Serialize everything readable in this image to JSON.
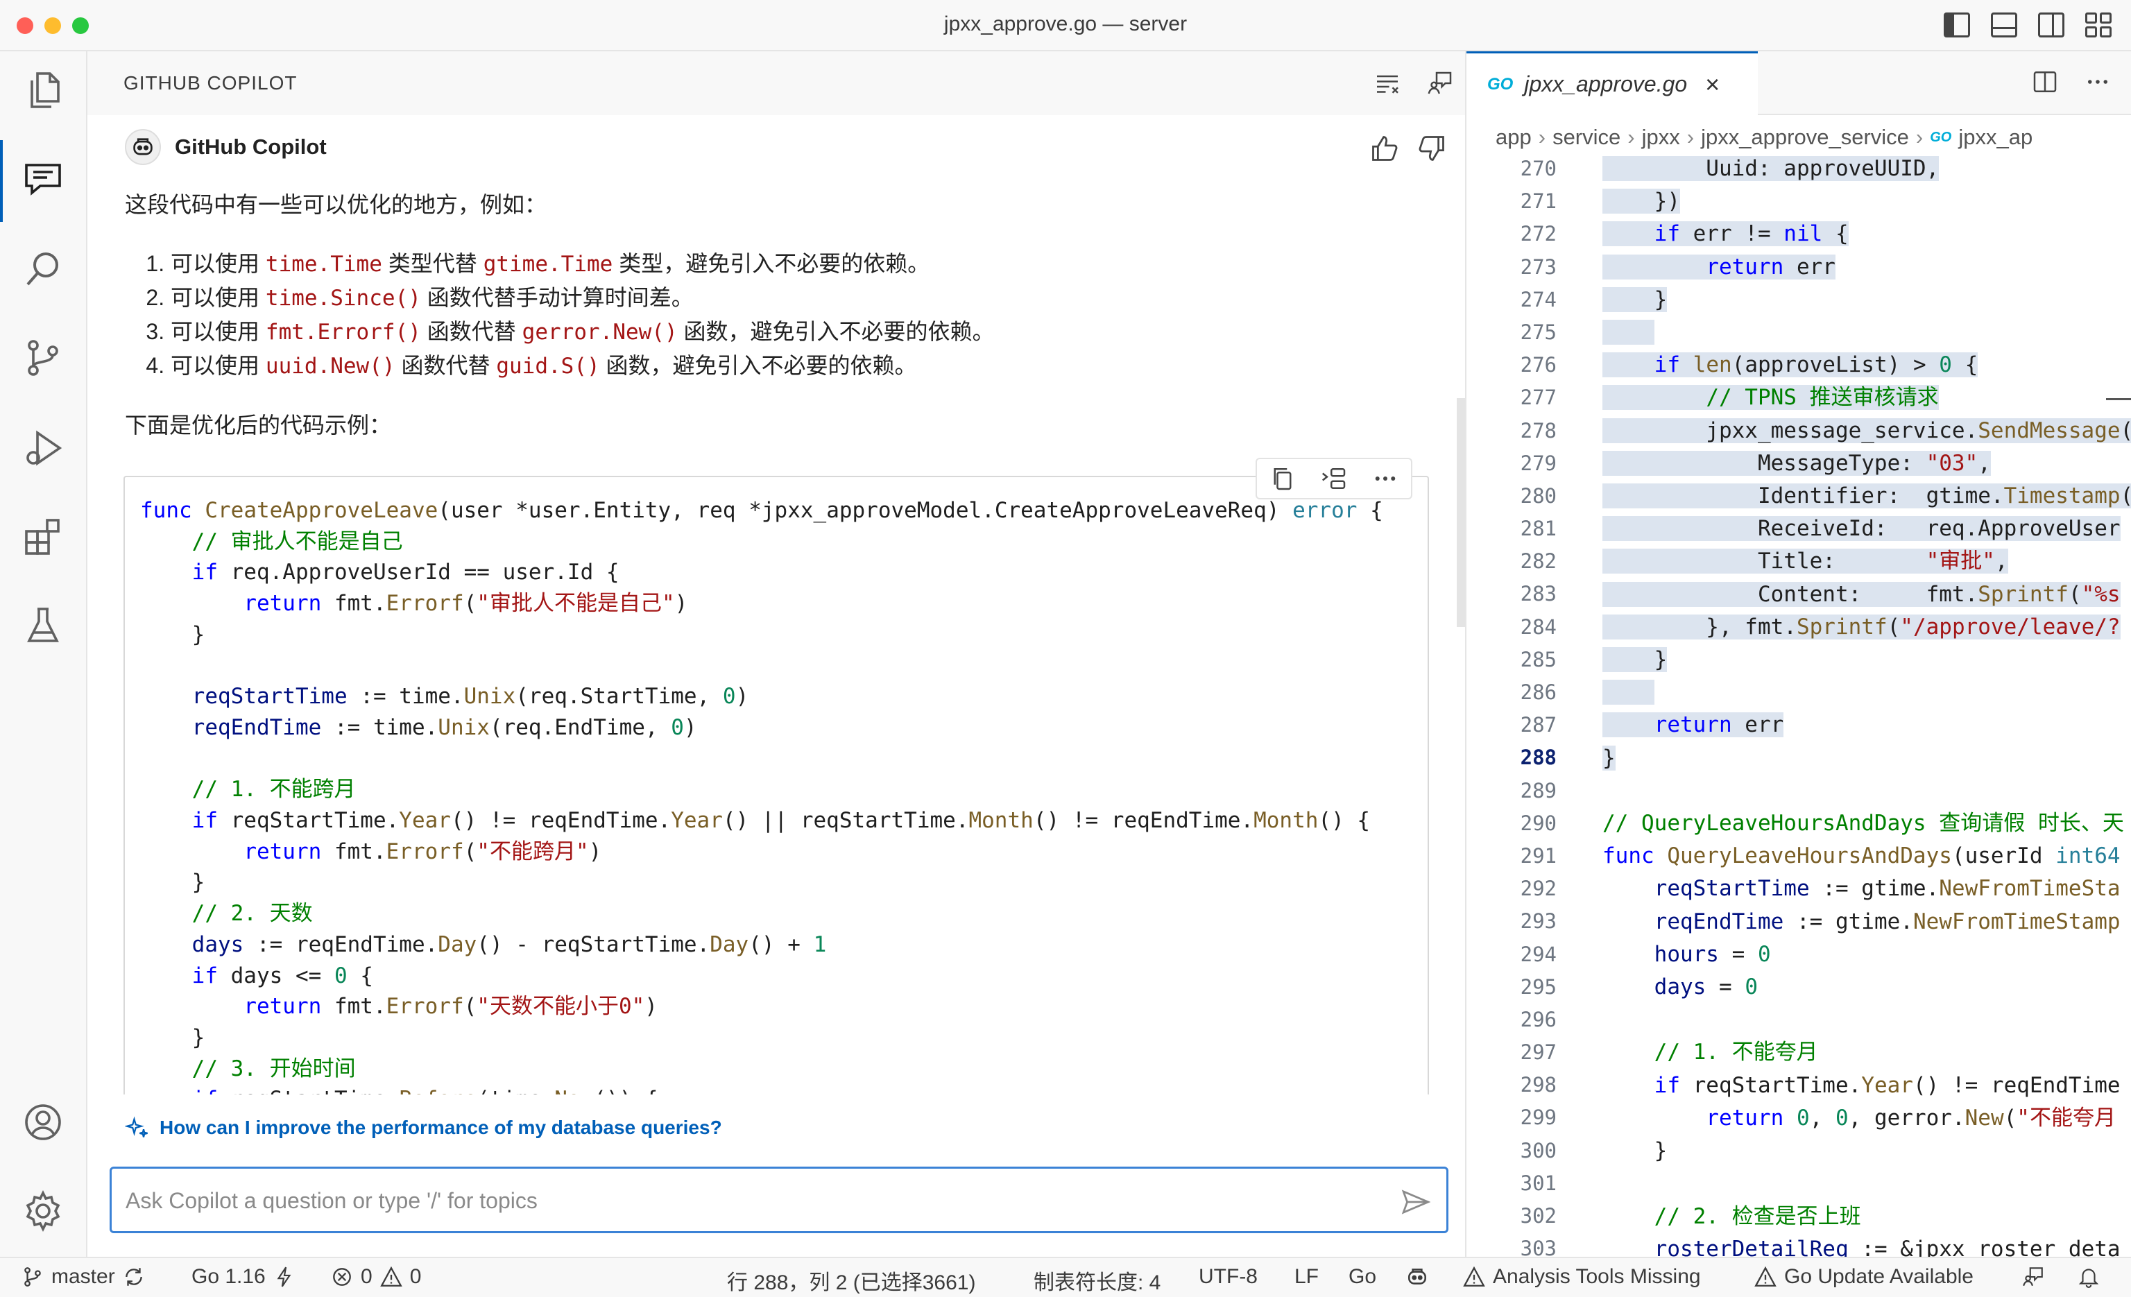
{
  "window": {
    "title": "jpxx_approve.go — server"
  },
  "activity_bar": {
    "items": [
      "explorer-icon",
      "chat-icon",
      "search-icon",
      "source-control-icon",
      "run-debug-icon",
      "extensions-icon",
      "testing-icon"
    ],
    "bottom": [
      "account-icon",
      "settings-gear-icon"
    ]
  },
  "copilot": {
    "panel_title": "GITHUB COPILOT",
    "bot_name": "GitHub Copilot",
    "intro": "这段代码中有一些可以优化的地方，例如：",
    "list": [
      {
        "pre": "可以使用 ",
        "code1": "time.Time",
        "mid": " 类型代替 ",
        "code2": "gtime.Time",
        "post": " 类型，避免引入不必要的依赖。"
      },
      {
        "pre": "可以使用 ",
        "code1": "time.Since()",
        "mid": " 函数代替手动计算时间差。",
        "code2": "",
        "post": ""
      },
      {
        "pre": "可以使用 ",
        "code1": "fmt.Errorf()",
        "mid": " 函数代替 ",
        "code2": "gerror.New()",
        "post": " 函数，避免引入不必要的依赖。"
      },
      {
        "pre": "可以使用 ",
        "code1": "uuid.New()",
        "mid": " 函数代替 ",
        "code2": "guid.S()",
        "post": " 函数，避免引入不必要的依赖。"
      }
    ],
    "after": "下面是优化后的代码示例：",
    "suggestion": "How can I improve the performance of my database queries?",
    "input_placeholder": "Ask Copilot a question or type '/' for topics",
    "input_value": ""
  },
  "editor": {
    "tab_lang": "GO",
    "tab_name": "jpxx_approve.go",
    "tab_close": "×",
    "breadcrumb": [
      "app",
      "service",
      "jpxx",
      "jpxx_approve_service",
      "jpxx_ap"
    ],
    "line_numbers": [
      "270",
      "271",
      "272",
      "273",
      "274",
      "275",
      "276",
      "277",
      "278",
      "279",
      "280",
      "281",
      "282",
      "283",
      "284",
      "285",
      "286",
      "287",
      "288",
      "289",
      "290",
      "291",
      "292",
      "293",
      "294",
      "295",
      "296",
      "297",
      "298",
      "299",
      "300",
      "301",
      "302",
      "303"
    ],
    "current_line": "288"
  },
  "status_bar": {
    "branch": "master",
    "go_version": "Go 1.16",
    "errors": "0",
    "warnings": "0",
    "cursor": "行 288，列 2 (已选择3661)",
    "tab_size": "制表符长度: 4",
    "encoding": "UTF-8",
    "eol": "LF",
    "language": "Go",
    "analysis": "Analysis Tools Missing",
    "update": "Go Update Available"
  },
  "colors": {
    "accent": "#005fb8",
    "selection": "#dce4ef",
    "string": "#a31515",
    "keyword": "#0000ff"
  }
}
